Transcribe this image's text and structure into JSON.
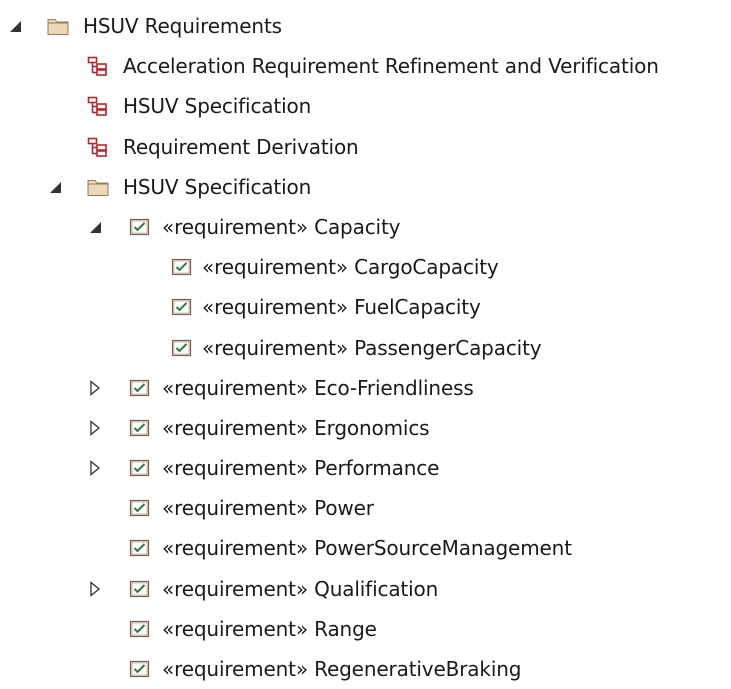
{
  "colors": {
    "folder_fill": "#ead8b8",
    "folder_stroke": "#9a7a52",
    "diagram_red": "#b3262c",
    "req_check": "#2c7a3f",
    "req_border": "#7a5a4a",
    "expander": "#333333"
  },
  "tree": {
    "root": {
      "label": "HSUV Requirements",
      "icon": "package-folder-icon",
      "expanded": true
    },
    "diagrams": [
      {
        "label": "Acceleration Requirement Refinement and Verification",
        "icon": "requirements-diagram-icon"
      },
      {
        "label": "HSUV Specification",
        "icon": "requirements-diagram-icon"
      },
      {
        "label": "Requirement Derivation",
        "icon": "requirements-diagram-icon"
      }
    ],
    "spec_package": {
      "label": "HSUV Specification",
      "icon": "package-folder-icon",
      "expanded": true
    },
    "capacity": {
      "label": "«requirement» Capacity",
      "icon": "requirement-icon",
      "expanded": true,
      "children": [
        {
          "label": "«requirement» CargoCapacity",
          "icon": "requirement-icon"
        },
        {
          "label": "«requirement» FuelCapacity",
          "icon": "requirement-icon"
        },
        {
          "label": "«requirement» PassengerCapacity",
          "icon": "requirement-icon"
        }
      ]
    },
    "requirements": [
      {
        "label": "«requirement» Eco-Friendliness",
        "icon": "requirement-icon",
        "has_children": true
      },
      {
        "label": "«requirement» Ergonomics",
        "icon": "requirement-icon",
        "has_children": true
      },
      {
        "label": "«requirement» Performance",
        "icon": "requirement-icon",
        "has_children": true
      },
      {
        "label": "«requirement» Power",
        "icon": "requirement-icon",
        "has_children": false
      },
      {
        "label": "«requirement» PowerSourceManagement",
        "icon": "requirement-icon",
        "has_children": false
      },
      {
        "label": "«requirement» Qualification",
        "icon": "requirement-icon",
        "has_children": true
      },
      {
        "label": "«requirement» Range",
        "icon": "requirement-icon",
        "has_children": false
      },
      {
        "label": "«requirement» RegenerativeBraking",
        "icon": "requirement-icon",
        "has_children": false
      }
    ]
  }
}
